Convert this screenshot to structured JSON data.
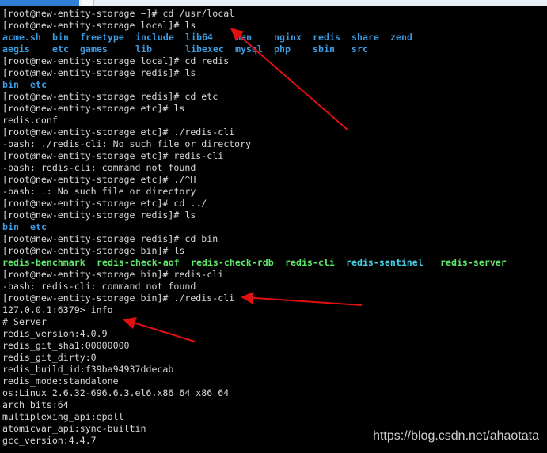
{
  "colors": {
    "dir": "#3d9be0",
    "exec": "#5ee86a",
    "cyan": "#45d3e6",
    "text": "#d8d8d8",
    "arrow": "#e01010"
  },
  "lines": [
    {
      "text": "[root@new-entity-storage ~]# cd /usr/local"
    },
    {
      "text": "[root@new-entity-storage local]# ls"
    },
    {
      "cols": [
        0,
        9,
        14,
        24,
        33,
        42,
        49,
        56,
        63,
        70
      ],
      "tokens": [
        {
          "t": "acme.sh",
          "c": "dir"
        },
        {
          "t": "bin",
          "c": "dir"
        },
        {
          "t": "freetype",
          "c": "dir"
        },
        {
          "t": "include",
          "c": "dir"
        },
        {
          "t": "lib64",
          "c": "dir"
        },
        {
          "t": "man",
          "c": "dir"
        },
        {
          "t": "nginx",
          "c": "dir"
        },
        {
          "t": "redis",
          "c": "dir"
        },
        {
          "t": "share",
          "c": "dir"
        },
        {
          "t": "zend",
          "c": "dir"
        }
      ]
    },
    {
      "cols": [
        0,
        9,
        14,
        24,
        33,
        42,
        49,
        56,
        63
      ],
      "tokens": [
        {
          "t": "aegis",
          "c": "dir"
        },
        {
          "t": "etc",
          "c": "dir"
        },
        {
          "t": "games",
          "c": "dir"
        },
        {
          "t": "lib",
          "c": "dir"
        },
        {
          "t": "libexec",
          "c": "dir"
        },
        {
          "t": "mysql",
          "c": "dir"
        },
        {
          "t": "php",
          "c": "dir"
        },
        {
          "t": "sbin",
          "c": "dir"
        },
        {
          "t": "src",
          "c": "dir"
        }
      ]
    },
    {
      "text": "[root@new-entity-storage local]# cd redis"
    },
    {
      "text": "[root@new-entity-storage redis]# ls"
    },
    {
      "cols": [
        0,
        5
      ],
      "tokens": [
        {
          "t": "bin",
          "c": "dir"
        },
        {
          "t": "etc",
          "c": "dir"
        }
      ]
    },
    {
      "text": "[root@new-entity-storage redis]# cd etc"
    },
    {
      "text": "[root@new-entity-storage etc]# ls"
    },
    {
      "text": "redis.conf"
    },
    {
      "text": "[root@new-entity-storage etc]# ./redis-cli"
    },
    {
      "text": "-bash: ./redis-cli: No such file or directory"
    },
    {
      "text": "[root@new-entity-storage etc]# redis-cli"
    },
    {
      "text": "-bash: redis-cli: command not found"
    },
    {
      "text": "[root@new-entity-storage etc]# ./^H"
    },
    {
      "text": "-bash: .: No such file or directory"
    },
    {
      "text": "[root@new-entity-storage etc]# cd ../"
    },
    {
      "text": "[root@new-entity-storage redis]# ls"
    },
    {
      "cols": [
        0,
        5
      ],
      "tokens": [
        {
          "t": "bin",
          "c": "dir"
        },
        {
          "t": "etc",
          "c": "dir"
        }
      ]
    },
    {
      "text": "[root@new-entity-storage redis]# cd bin"
    },
    {
      "text": "[root@new-entity-storage bin]# ls"
    },
    {
      "cols": [
        0,
        17,
        34,
        51,
        62,
        79
      ],
      "tokens": [
        {
          "t": "redis-benchmark",
          "c": "exec"
        },
        {
          "t": "redis-check-aof",
          "c": "exec"
        },
        {
          "t": "redis-check-rdb",
          "c": "exec"
        },
        {
          "t": "redis-cli",
          "c": "exec"
        },
        {
          "t": "redis-sentinel",
          "c": "cyan"
        },
        {
          "t": "redis-server",
          "c": "exec"
        }
      ]
    },
    {
      "text": "[root@new-entity-storage bin]# redis-cli"
    },
    {
      "text": "-bash: redis-cli: command not found"
    },
    {
      "text": "[root@new-entity-storage bin]# ./redis-cli"
    },
    {
      "text": "127.0.0.1:6379> info"
    },
    {
      "text": "# Server"
    },
    {
      "text": "redis_version:4.0.9"
    },
    {
      "text": "redis_git_sha1:00000000"
    },
    {
      "text": "redis_git_dirty:0"
    },
    {
      "text": "redis_build_id:f39ba94937ddecab"
    },
    {
      "text": "redis_mode:standalone"
    },
    {
      "text": "os:Linux 2.6.32-696.6.3.el6.x86_64 x86_64"
    },
    {
      "text": "arch_bits:64"
    },
    {
      "text": "multiplexing_api:epoll"
    },
    {
      "text": "atomicvar_api:sync-builtin"
    },
    {
      "text": "gcc_version:4.4.7"
    }
  ],
  "watermark": "https://blog.csdn.net/ahaotata"
}
